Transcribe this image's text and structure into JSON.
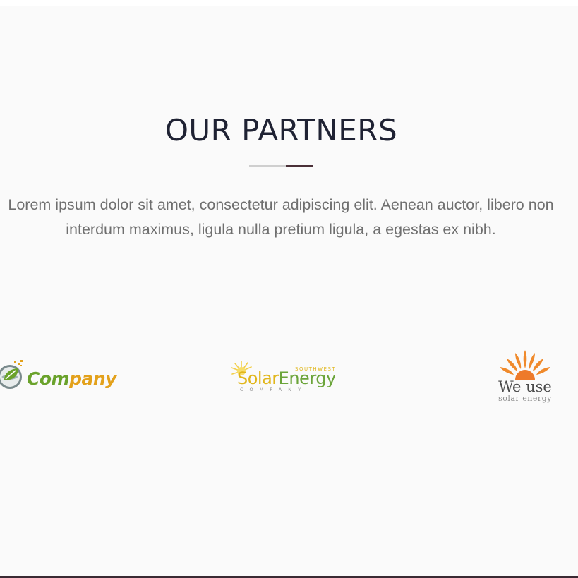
{
  "section": {
    "title": "OUR PARTNERS",
    "description_line1": "Lorem ipsum dolor sit amet, consectetur adipiscing elit. Aenean auctor, libero non",
    "description_line2": "interdum maximus, ligula nulla pretium ligula, a egestas ex nibh."
  },
  "colors": {
    "background": "#fafafa",
    "title": "#1f2233",
    "text": "#6f6f6f",
    "accent": "#4a3038",
    "divider_light": "#cfcfcf"
  },
  "partners": [
    {
      "name": "company-logo",
      "text_part1": "Com",
      "text_part2": "pany",
      "icon": "globe-leaf-icon"
    },
    {
      "name": "solar-energy-logo",
      "tagline_top": "SOUTHWEST",
      "text_part1": "Solar",
      "text_part2": "Energy",
      "tagline_bottom": "COMPANY",
      "icon": "sun-rays-icon"
    },
    {
      "name": "we-use-solar-energy-logo",
      "text_main": "We use",
      "text_sub": "solar energy",
      "icon": "sunrise-icon"
    }
  ]
}
